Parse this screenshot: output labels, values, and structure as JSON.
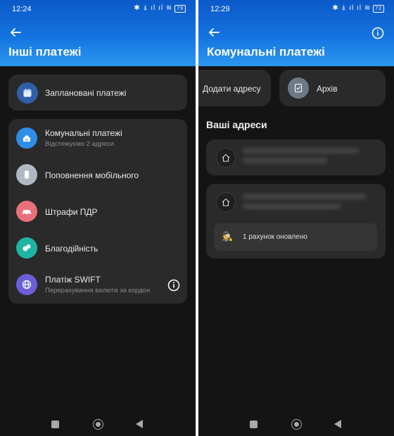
{
  "left": {
    "status_time": "12:24",
    "battery": "79",
    "title": "Інші платежі",
    "scheduled": {
      "label": "Заплановані платежі"
    },
    "items": [
      {
        "label": "Комунальні платежі",
        "sub": "Відстежуємо 2 адреси"
      },
      {
        "label": "Поповнення мобільного"
      },
      {
        "label": "Штрафи ПДР"
      },
      {
        "label": "Благодійність"
      },
      {
        "label": "Платіж SWIFT",
        "sub": "Перерахування валюти за кордон"
      }
    ]
  },
  "right": {
    "status_time": "12:29",
    "battery": "72",
    "title": "Комунальні платежі",
    "add_address": "Додати адресу",
    "archive": "Архів",
    "section_title": "Ваші адреси",
    "update_notice": "1 рахунок оновлено"
  },
  "colors": {
    "header_gradient_top": "#0c59c9",
    "header_gradient_bottom": "#2b97f0",
    "card": "#2a2a2a",
    "background": "#141414",
    "scheduled_icon": "#2f5fa8",
    "utility_icon": "#2f8fe8",
    "mobile_icon": "#b0b8c4",
    "fines_icon": "#e9707a",
    "charity_icon": "#1fb5a5",
    "swift_icon": "#6a5fd8"
  }
}
